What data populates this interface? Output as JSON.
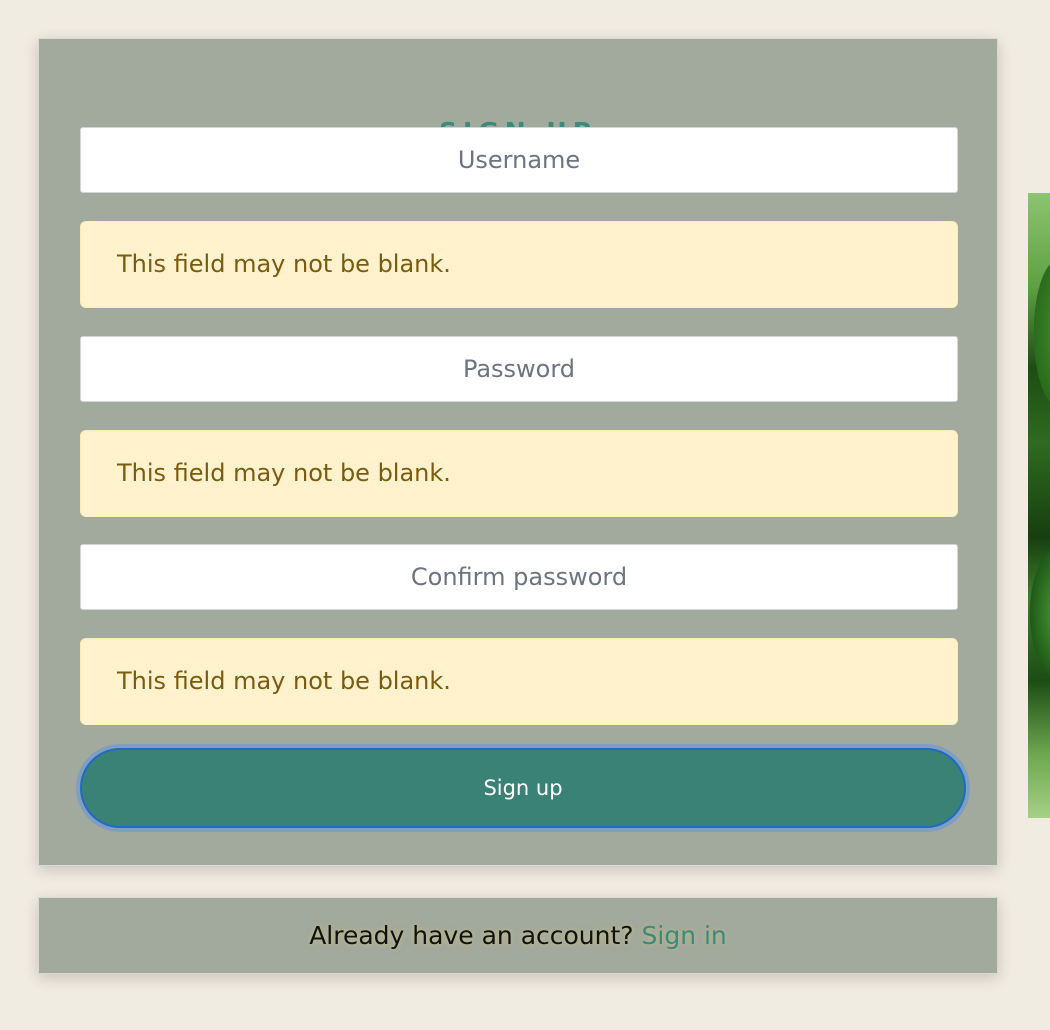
{
  "signup": {
    "title": "SIGN UP",
    "username_placeholder": "Username",
    "username_error": "This field may not be blank.",
    "password_placeholder": "Password",
    "password_error": "This field may not be blank.",
    "confirm_placeholder": "Confirm password",
    "confirm_error": "This field may not be blank.",
    "submit_label": "Sign up"
  },
  "signin": {
    "prompt": "Already have an account?",
    "link_label": "Sign in"
  },
  "colors": {
    "page_background": "#f1ece2",
    "card_background": "#a2a99d",
    "accent": "#3a8b7d",
    "alert_background": "#fff2cd",
    "alert_text": "#7a5b12",
    "button_background": "#3a8176"
  }
}
